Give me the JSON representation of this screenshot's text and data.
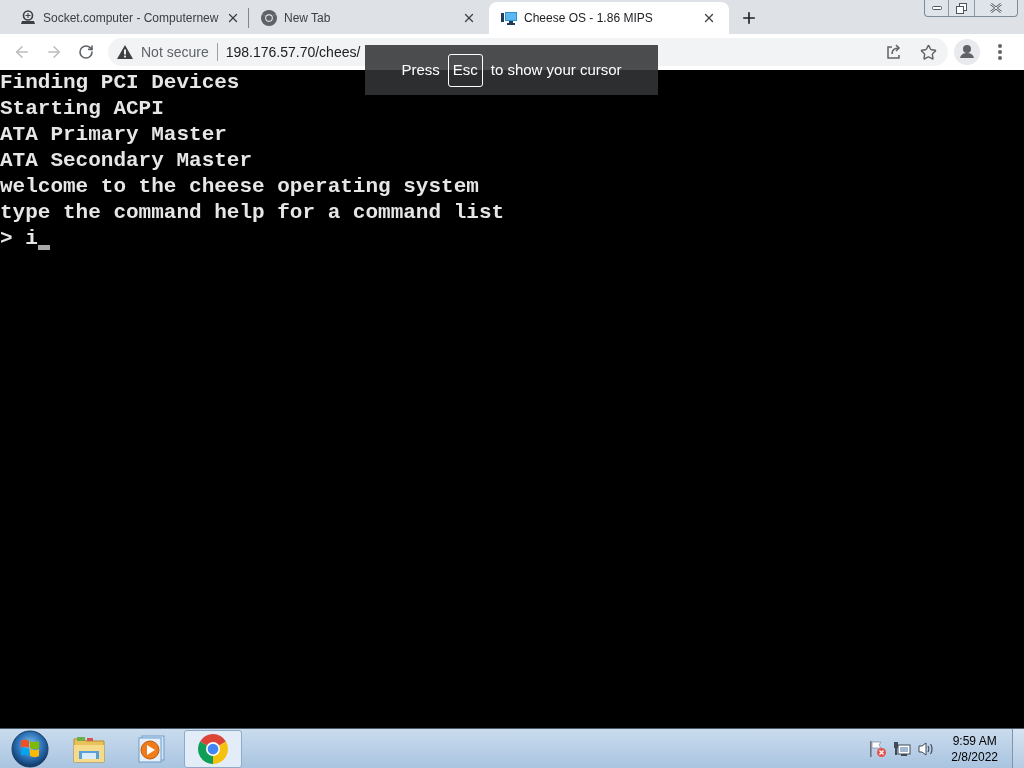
{
  "browser": {
    "tabs": [
      {
        "title": "Socket.computer - Computernew",
        "selected": false
      },
      {
        "title": "New Tab",
        "selected": false
      },
      {
        "title": "Cheese OS - 1.86 MIPS",
        "selected": true
      }
    ],
    "address_bar": {
      "security_label": "Not secure",
      "url": "198.176.57.70/chees/"
    }
  },
  "fullscreen_notice": {
    "before": "Press",
    "key": "Esc",
    "after": "to show your cursor"
  },
  "terminal": {
    "lines": [
      "Finding PCI Devices",
      "Starting ACPI",
      "ATA Primary Master",
      "ATA Secondary Master",
      "welcome to the cheese operating system",
      "type the command help for a command list"
    ],
    "prompt": ">",
    "input": "i"
  },
  "taskbar": {
    "apps": [
      {
        "selected": false
      },
      {
        "selected": false
      },
      {
        "selected": true
      }
    ],
    "clock": {
      "time": "9:59 AM",
      "date": "2/8/2022"
    }
  }
}
